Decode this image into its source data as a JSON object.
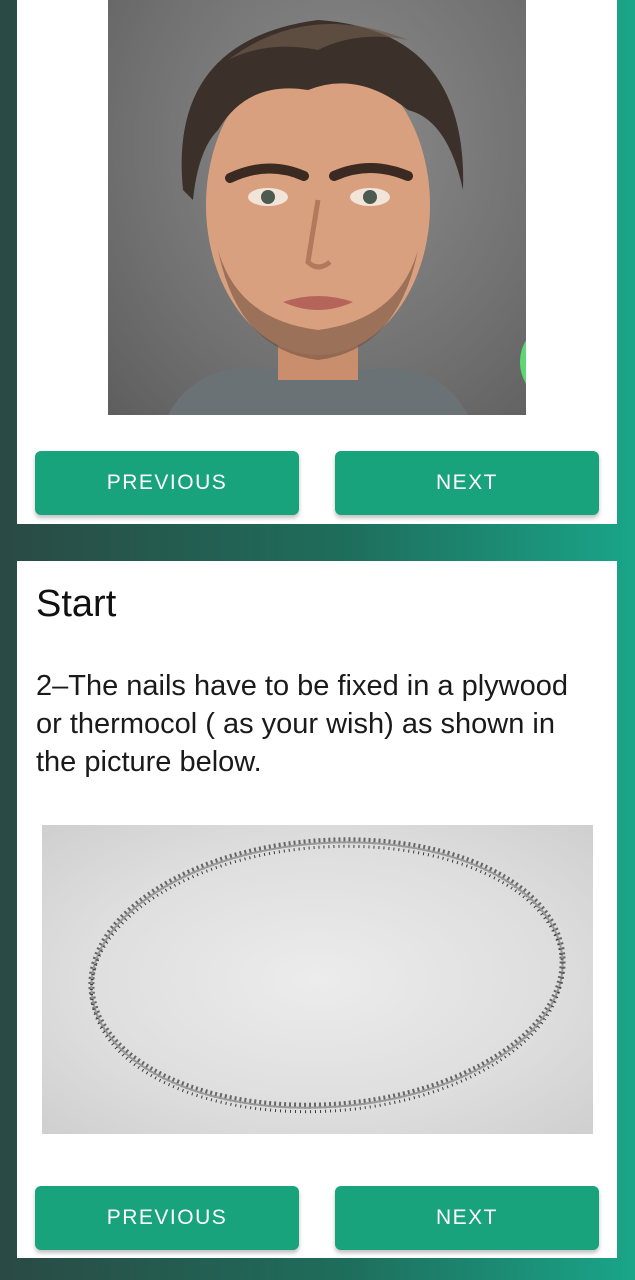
{
  "card1": {
    "photo_icon": "portrait-photo",
    "badge_icon": "check-icon",
    "prev_label": "PREVIOUS",
    "next_label": "NEXT"
  },
  "card2": {
    "title": "Start",
    "description": "2–The nails have to be fixed in a plywood or thermocol ( as your wish) as shown in the picture below.",
    "image_icon": "nails-circle-photo",
    "prev_label": "PREVIOUS",
    "next_label": "NEXT"
  },
  "colors": {
    "accent": "#18a37c",
    "badge": "#5ed674",
    "card": "#ffffff"
  }
}
